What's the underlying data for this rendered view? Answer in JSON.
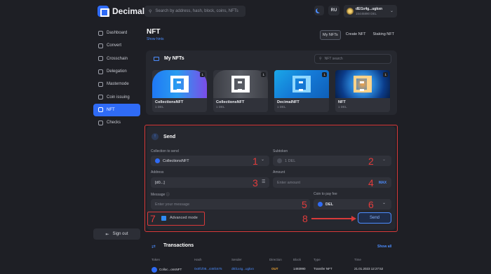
{
  "app": {
    "name": "Decimal"
  },
  "search": {
    "placeholder": "Search by address, hash, block, coins, NFTs"
  },
  "header": {
    "language": "RU",
    "wallet_address": "dEl1x4g...ugkxn",
    "wallet_balance": "15445890 DEL"
  },
  "sidebar": {
    "items": [
      {
        "label": "Dashboard",
        "icon": "dashboard-icon"
      },
      {
        "label": "Convert",
        "icon": "convert-icon"
      },
      {
        "label": "Crosschain",
        "icon": "crosschain-icon"
      },
      {
        "label": "Delegation",
        "icon": "delegation-icon"
      },
      {
        "label": "Masternode",
        "icon": "masternode-icon"
      },
      {
        "label": "Coin issuing",
        "icon": "coin-issuing-icon"
      },
      {
        "label": "NFT",
        "icon": "nft-icon",
        "active": true
      },
      {
        "label": "Checks",
        "icon": "checks-icon"
      }
    ],
    "sign_out": "Sign out"
  },
  "page": {
    "title": "NFT",
    "show_hints": "Show hints",
    "tabs": [
      "My NFTs",
      "Create NFT",
      "Staking NFT"
    ]
  },
  "my_nfts": {
    "title": "My NFTs",
    "search_placeholder": "NFT search",
    "cards": [
      {
        "name": "CollectionsNFT",
        "price": "1 DEL",
        "count": "1"
      },
      {
        "name": "CollectionsNFT",
        "price": "1 DEL",
        "count": "1"
      },
      {
        "name": "DecimalNFT",
        "price": "1 DEL",
        "count": "1"
      },
      {
        "name": "NFT",
        "price": "1 DEL",
        "count": "1"
      }
    ]
  },
  "send": {
    "title": "Send",
    "collection_label": "Collection to send",
    "collection_value": "CollectionsNFT",
    "subtoken_label": "Subtoken",
    "subtoken_value": "1 DEL",
    "address_label": "Address",
    "address_value": "[d0...]",
    "amount_label": "Amount",
    "amount_placeholder": "Enter amount",
    "max_label": "MAX",
    "message_label": "Message",
    "message_placeholder": "Enter your message",
    "coin_fee_label": "Coin to pay fee",
    "coin_fee_value": "DEL",
    "advanced_mode": "Advanced mode",
    "send_button": "Send",
    "annotations": [
      "1",
      "2",
      "3",
      "4",
      "5",
      "6",
      "7",
      "8"
    ],
    "annotation_color": "#e23c3c"
  },
  "transactions": {
    "title": "Transactions",
    "show_all": "Show all",
    "columns": [
      "Token",
      "Hash",
      "Sender",
      "Direction",
      "Block",
      "Type",
      "Time"
    ],
    "rows": [
      {
        "token": "Colloc...onsNFT",
        "hash": "0x0f1f08...446fc675",
        "sender": "dEl1x4g...ugkxn",
        "direction": "OUT",
        "block": "1493990",
        "type": "Transfer NFT",
        "time": "21.01.2023 12:27:52"
      }
    ]
  },
  "colors": {
    "accent": "#2f6bf6",
    "background": "#1e1f25",
    "panel": "#26282f",
    "highlight": "#d83a3a"
  }
}
